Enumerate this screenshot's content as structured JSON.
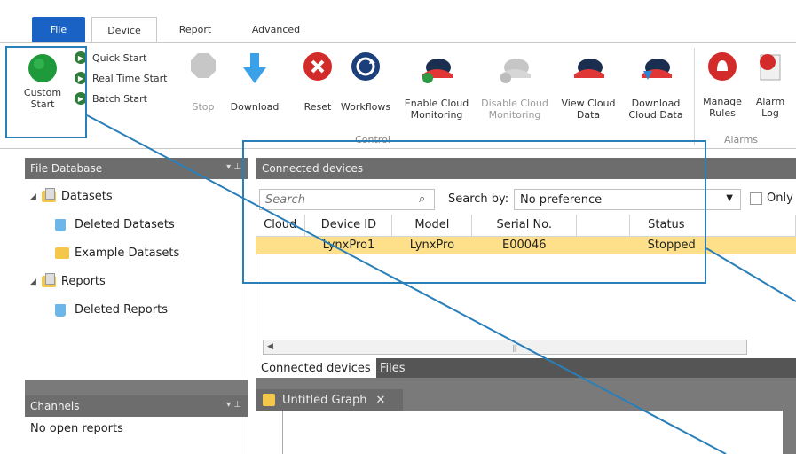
{
  "ribbon_tabs": {
    "file": "File",
    "device": "Device",
    "report": "Report",
    "advanced": "Advanced"
  },
  "ribbon": {
    "custom_start": "Custom\nStart",
    "quick_start": "Quick Start",
    "real_time_start": "Real Time Start",
    "batch_start": "Batch Start",
    "stop": "Stop",
    "download": "Download",
    "reset": "Reset",
    "workflows": "Workflows",
    "enable_cloud": "Enable Cloud\nMonitoring",
    "disable_cloud": "Disable Cloud\nMonitoring",
    "view_cloud": "View Cloud\nData",
    "download_cloud": "Download\nCloud Data",
    "manage_rules": "Manage\nRules",
    "alarm_log": "Alarm\nLog",
    "group_control": "Control",
    "group_alarms": "Alarms"
  },
  "file_database": {
    "title": "File Database",
    "items": [
      {
        "label": "Datasets"
      },
      {
        "label": "Deleted Datasets"
      },
      {
        "label": "Example Datasets"
      },
      {
        "label": "Reports"
      },
      {
        "label": "Deleted Reports"
      }
    ]
  },
  "channels": {
    "title": "Channels",
    "empty_text": "No open reports"
  },
  "connected_devices": {
    "title": "Connected devices",
    "search_placeholder": "Search",
    "search_by_label": "Search by:",
    "search_by_value": "No preference",
    "only_label": "Only",
    "columns": [
      "Cloud",
      "Device ID",
      "Model",
      "Serial No.",
      "",
      "Status"
    ],
    "rows": [
      {
        "cloud": "",
        "device_id": "LynxPro1",
        "model": "LynxPro",
        "serial": "E00046",
        "blank": "",
        "status": "Stopped"
      }
    ]
  },
  "bottom_tabs": {
    "connected_devices": "Connected devices",
    "files": "Files"
  },
  "graph": {
    "tab_label": "Untitled Graph",
    "close": "✕"
  },
  "colors": {
    "accent_blue": "#1a62c4",
    "selected_row": "#fde089",
    "callout": "#2a7fb8"
  }
}
